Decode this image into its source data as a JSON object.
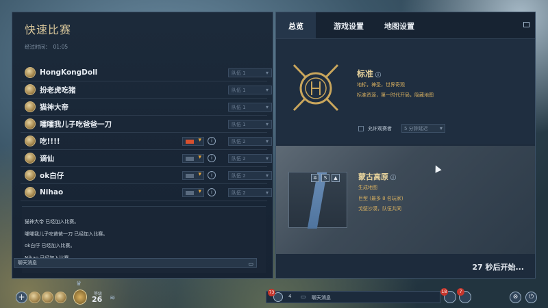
{
  "lobby": {
    "title": "快速比赛",
    "elapsed_label": "经过时间：",
    "elapsed_value": "01:05"
  },
  "players": [
    {
      "name": "HongKongDoll",
      "team": "队伍 1",
      "flag": false
    },
    {
      "name": "扮老虎吃猪",
      "team": "队伍 1",
      "flag": false
    },
    {
      "name": "猫神大帝",
      "team": "队伍 1",
      "flag": false
    },
    {
      "name": "嚯嚯我儿子吃爸爸一刀",
      "team": "队伍 1",
      "flag": false
    },
    {
      "name": "吃!!!!",
      "team": "队伍 2",
      "flag": true,
      "flag_color": "#d8502e"
    },
    {
      "name": "谪仙",
      "team": "队伍 2",
      "flag": true,
      "flag_color": "#5a6b7f"
    },
    {
      "name": "ok白仔",
      "team": "队伍 2",
      "flag": true,
      "flag_color": "#5a6b7f"
    },
    {
      "name": "Nihao",
      "team": "队伍 2",
      "flag": true,
      "flag_color": "#5a6b7f"
    }
  ],
  "chat": {
    "messages": [
      "猫神大帝 已经加入比赛。",
      "嚯嚯我儿子吃爸爸一刀 已经加入比赛。",
      "ok白仔 已经加入比赛。",
      "Nihao 已经加入比赛。"
    ],
    "input_placeholder": "聊天消息"
  },
  "tabs": [
    "总览",
    "游戏设置",
    "地图设置"
  ],
  "overview": {
    "mode_title": "标准",
    "mode_info_icon": "ⓘ",
    "mode_sub": "地标，神圣，世界奇观",
    "mode_desc": "标准资源，第一时代开局，隐藏地图",
    "spectate_label": "允许观赛者",
    "spectate_delay": "5 分钟延迟"
  },
  "map": {
    "name": "蒙古高原",
    "info_icon": "ⓘ",
    "type": "生成地图",
    "size": "巨型 (最多 8 名玩家)",
    "resources": "戈壁沙漠，队伍共同"
  },
  "countdown": "27 秒后开始...",
  "bottom_bar": {
    "level_label": "等级",
    "level_value": "26",
    "notif_badge": "73",
    "online_count": "4",
    "chat_label": "聊天消息",
    "badge_right_1": "18",
    "badge_right_2": "7"
  }
}
